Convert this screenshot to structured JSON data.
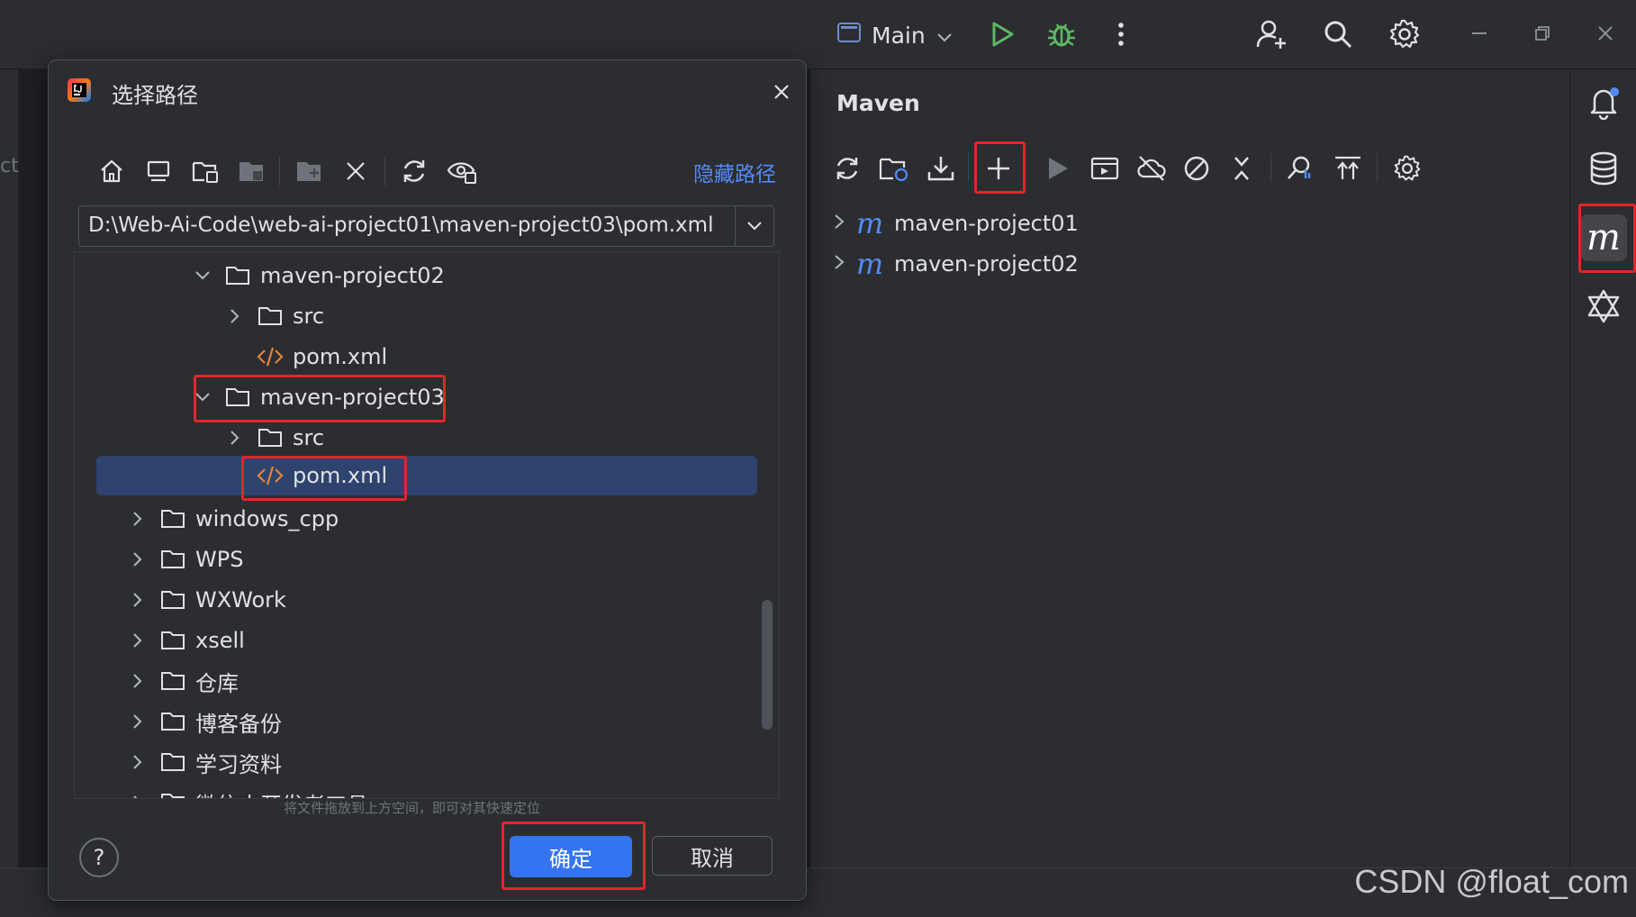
{
  "titlebar": {
    "run_config": "Main",
    "icons": [
      "run-config-icon",
      "run-icon",
      "debug-icon",
      "more-vertical-icon",
      "add-user-icon",
      "search-icon",
      "settings-icon",
      "minimize-icon",
      "restore-icon",
      "close-icon"
    ]
  },
  "left_strip": {
    "text": "ct"
  },
  "maven": {
    "title": "Maven",
    "toolbar_icons": [
      "reload-icon",
      "reload-folder-icon",
      "download-icon",
      "add-icon",
      "run-icon",
      "execute-goal-icon",
      "offline-icon",
      "skip-tests-icon",
      "collapse-icon",
      "show-dependencies-icon",
      "expand-all-icon",
      "settings-icon"
    ],
    "projects": [
      {
        "label": "maven-project01"
      },
      {
        "label": "maven-project02"
      }
    ]
  },
  "right_bar": {
    "icons": [
      "notifications-icon",
      "database-icon",
      "maven-icon",
      "ai-assistant-icon"
    ]
  },
  "dialog": {
    "title": "选择路径",
    "hide_path_label": "隐藏路径",
    "path": "D:\\Web-Ai-Code\\web-ai-project01\\maven-project03\\pom.xml",
    "toolbar_icons": [
      "home-icon",
      "desktop-icon",
      "project-folder-icon",
      "module-folder-icon",
      "new-folder-icon",
      "delete-icon",
      "refresh-icon",
      "show-hidden-icon"
    ],
    "tree": [
      {
        "label": "maven-project02",
        "type": "folder",
        "expanded": true
      },
      {
        "label": "src",
        "type": "folder",
        "expanded": false
      },
      {
        "label": "pom.xml",
        "type": "xml"
      },
      {
        "label": "maven-project03",
        "type": "folder",
        "expanded": true
      },
      {
        "label": "src",
        "type": "folder",
        "expanded": false
      },
      {
        "label": "pom.xml",
        "type": "xml",
        "selected": true
      },
      {
        "label": "windows_cpp",
        "type": "folder"
      },
      {
        "label": "WPS",
        "type": "folder"
      },
      {
        "label": "WXWork",
        "type": "folder"
      },
      {
        "label": "xsell",
        "type": "folder"
      },
      {
        "label": "仓库",
        "type": "folder"
      },
      {
        "label": "博客备份",
        "type": "folder"
      },
      {
        "label": "学习资料",
        "type": "folder"
      },
      {
        "label": "微信小开发者工具",
        "type": "folder"
      }
    ],
    "hint": "将文件拖放到上方空间，即可对其快速定位",
    "help_label": "?",
    "ok_label": "确定",
    "cancel_label": "取消"
  },
  "watermark": "CSDN @float_com",
  "colors": {
    "accent": "#3574f0",
    "highlight": "#e0262c",
    "selection": "#2e436e",
    "run": "#5fb865",
    "maven": "#548af7",
    "xml": "#e0843c"
  }
}
